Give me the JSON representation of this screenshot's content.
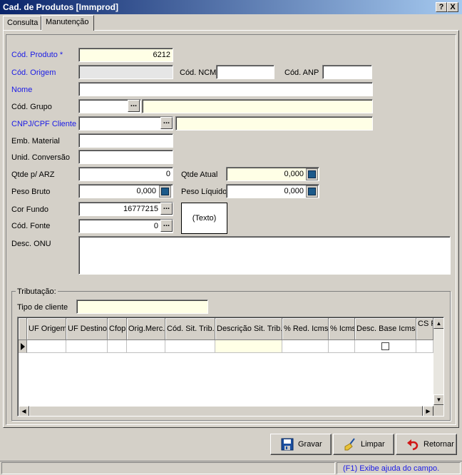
{
  "window": {
    "title": "Cad. de Produtos [Immprod]",
    "help_btn": "?",
    "close_btn": "X"
  },
  "tabs": [
    {
      "label": "Consulta"
    },
    {
      "label": "Manutenção"
    }
  ],
  "form": {
    "cod_produto": {
      "label": "Cód. Produto *",
      "value": "6212"
    },
    "cod_origem": {
      "label": "Cód. Origem",
      "value": ""
    },
    "cod_ncm": {
      "label": "Cód. NCM",
      "value": ""
    },
    "cod_anp": {
      "label": "Cód. ANP",
      "value": ""
    },
    "nome": {
      "label": "Nome",
      "value": ""
    },
    "cod_grupo": {
      "label": "Cód. Grupo",
      "value": "",
      "desc": ""
    },
    "cnpj_cliente": {
      "label": "CNPJ/CPF Cliente",
      "value": "",
      "desc": ""
    },
    "emb_material": {
      "label": "Emb. Material",
      "value": ""
    },
    "unid_conversao": {
      "label": "Unid. Conversão",
      "value": ""
    },
    "qtde_arz": {
      "label": "Qtde p/ ARZ",
      "value": "0"
    },
    "qtde_atual": {
      "label": "Qtde Atual",
      "value": "0,000"
    },
    "peso_bruto": {
      "label": "Peso Bruto",
      "value": "0,000"
    },
    "peso_liquido": {
      "label": "Peso Líquido",
      "value": "0,000"
    },
    "cor_fundo": {
      "label": "Cor Fundo",
      "value": "16777215"
    },
    "cod_fonte": {
      "label": "Cód. Fonte",
      "value": "0"
    },
    "texto_preview": "(Texto)",
    "desc_onu": {
      "label": "Desc. ONU",
      "value": ""
    },
    "ellipsis": "..."
  },
  "tributacao": {
    "group_label": "Tributação:",
    "tipo_cliente": {
      "label": "Tipo de cliente",
      "value": ""
    },
    "columns": [
      "UF Origem",
      "UF Destino",
      "Cfop",
      "Orig.Merc.",
      "Cód. Sit. Trib.",
      "Descrição Sit. Trib.",
      "% Red. Icms",
      "% Icms",
      "Desc. Base Icms",
      "CS Pi"
    ]
  },
  "buttons": {
    "gravar": "Gravar",
    "limpar": "Limpar",
    "retornar": "Retornar"
  },
  "status": {
    "help": "(F1) Exibe ajuda do campo."
  },
  "colors": {
    "titlebar_start": "#0a246a",
    "titlebar_end": "#a6caf0",
    "required_label": "#1a1ae6",
    "highlight_field": "#ffffe6"
  }
}
